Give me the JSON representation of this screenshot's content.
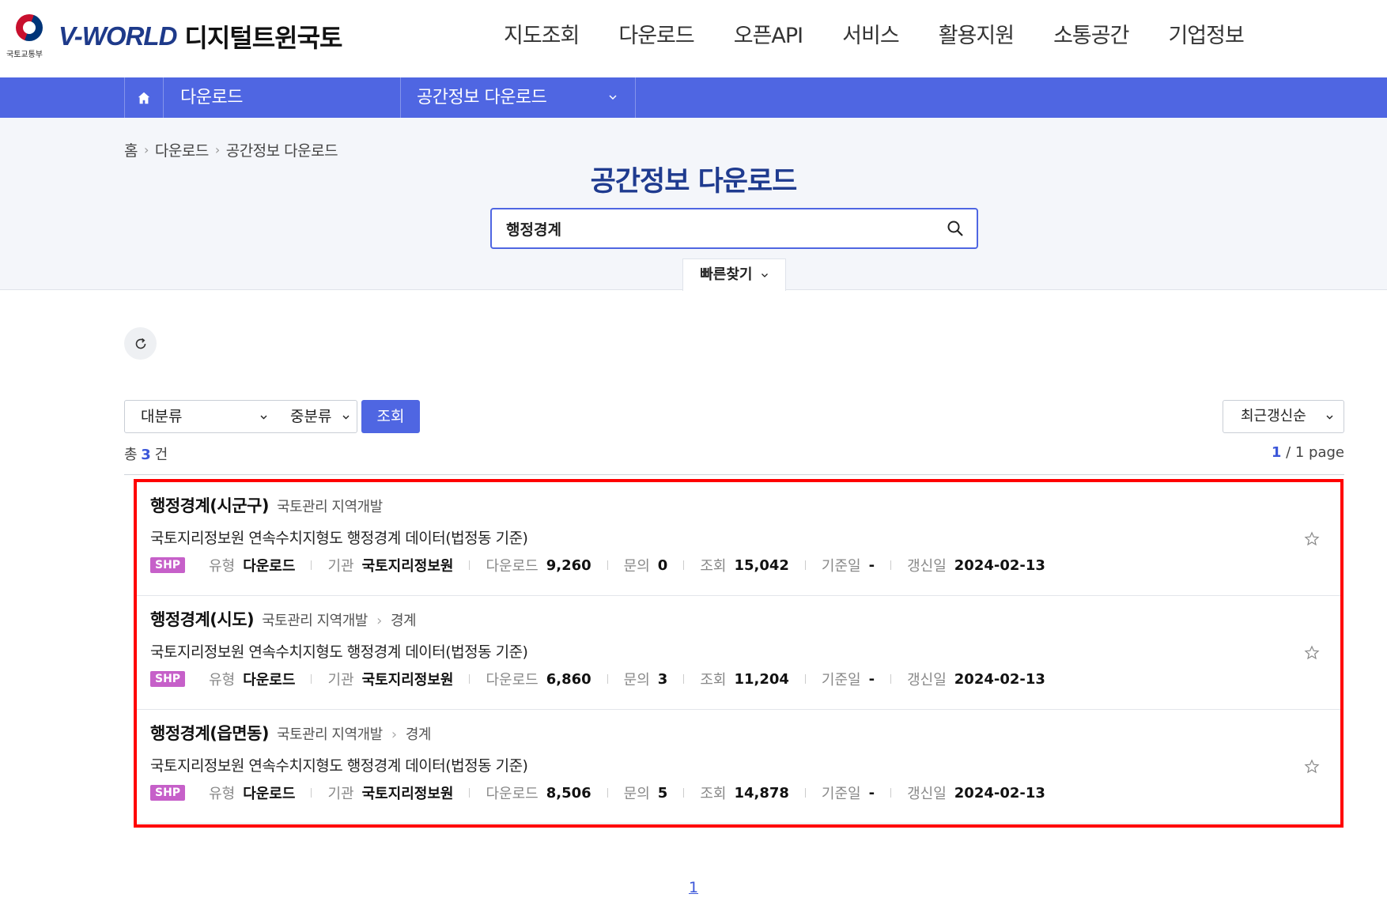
{
  "header": {
    "ministry_text": "국토교통부",
    "brand_main": "V-WORLD",
    "brand_sub": "디지털트윈국토",
    "nav": [
      "지도조회",
      "다운로드",
      "오픈API",
      "서비스",
      "활용지원",
      "소통공간",
      "기업정보"
    ]
  },
  "subnav": {
    "crumb1": "다운로드",
    "crumb2": "공간정보 다운로드"
  },
  "breadcrumb": [
    "홈",
    "다운로드",
    "공간정보 다운로드"
  ],
  "page_title": "공간정보 다운로드",
  "search": {
    "value": "행정경계",
    "quick_find": "빠른찾기"
  },
  "filters": {
    "major": "대분류",
    "middle": "중분류",
    "query": "조회",
    "sort": "최근갱신순"
  },
  "total": {
    "prefix": "총",
    "count": "3",
    "suffix": "건"
  },
  "paging": {
    "current": "1",
    "rest": "/ 1 page"
  },
  "meta_labels": {
    "type": "유형",
    "org": "기관",
    "downloads": "다운로드",
    "inquiries": "문의",
    "views": "조회",
    "base_date": "기준일",
    "updated": "갱신일"
  },
  "results": [
    {
      "title": "행정경계(시군구)",
      "category": "국토관리 지역개발",
      "subcategory": "",
      "desc": "국토지리정보원 연속수치지형도 행정경계 데이터(법정동 기준)",
      "format": "SHP",
      "type": "다운로드",
      "org": "국토지리정보원",
      "downloads": "9,260",
      "inquiries": "0",
      "views": "15,042",
      "base_date": "-",
      "updated": "2024-02-13"
    },
    {
      "title": "행정경계(시도)",
      "category": "국토관리 지역개발",
      "subcategory": "경계",
      "desc": "국토지리정보원 연속수치지형도 행정경계 데이터(법정동 기준)",
      "format": "SHP",
      "type": "다운로드",
      "org": "국토지리정보원",
      "downloads": "6,860",
      "inquiries": "3",
      "views": "11,204",
      "base_date": "-",
      "updated": "2024-02-13"
    },
    {
      "title": "행정경계(읍면동)",
      "category": "국토관리 지역개발",
      "subcategory": "경계",
      "desc": "국토지리정보원 연속수치지형도 행정경계 데이터(법정동 기준)",
      "format": "SHP",
      "type": "다운로드",
      "org": "국토지리정보원",
      "downloads": "8,506",
      "inquiries": "5",
      "views": "14,878",
      "base_date": "-",
      "updated": "2024-02-13"
    }
  ],
  "pagination": {
    "page": "1"
  },
  "colors": {
    "accent": "#4f66e2",
    "title": "#1f3b8f",
    "highlight_border": "#ff0000",
    "shp_badge": "#c660c9"
  }
}
